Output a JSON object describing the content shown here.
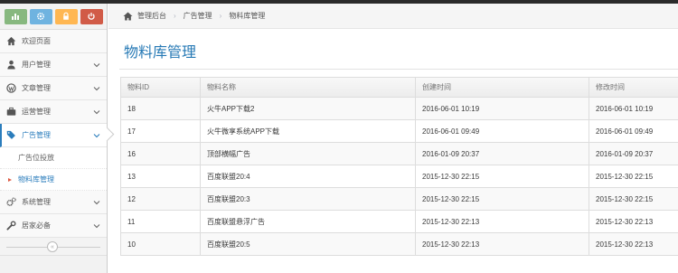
{
  "sidebar": {
    "items": [
      {
        "label": "欢迎页面",
        "icon": "home-icon",
        "has_children": false
      },
      {
        "label": "用户管理",
        "icon": "user-icon",
        "has_children": true
      },
      {
        "label": "文章管理",
        "icon": "wordpress-icon",
        "has_children": true
      },
      {
        "label": "运营管理",
        "icon": "briefcase-icon",
        "has_children": true
      },
      {
        "label": "广告管理",
        "icon": "tags-icon",
        "has_children": true,
        "open": true
      },
      {
        "label": "系统管理",
        "icon": "cogs-icon",
        "has_children": true
      },
      {
        "label": "居家必备",
        "icon": "wrench-icon",
        "has_children": true
      }
    ],
    "subitems": [
      "广告位投放",
      "物料库管理"
    ]
  },
  "breadcrumb": {
    "home": "管理后台",
    "level1": "广告管理",
    "level2": "物料库管理"
  },
  "page": {
    "title": "物料库管理"
  },
  "table": {
    "columns": [
      "物料ID",
      "物料名称",
      "创建时间",
      "修改时间"
    ],
    "rows": [
      [
        "18",
        "火牛APP下载2",
        "2016-06-01 10:19",
        "2016-06-01 10:19"
      ],
      [
        "17",
        "火牛微享系统APP下载",
        "2016-06-01 09:49",
        "2016-06-01 09:49"
      ],
      [
        "16",
        "顶部横幅广告",
        "2016-01-09 20:37",
        "2016-01-09 20:37"
      ],
      [
        "13",
        "百度联盟20:4",
        "2015-12-30 22:15",
        "2015-12-30 22:15"
      ],
      [
        "12",
        "百度联盟20:3",
        "2015-12-30 22:15",
        "2015-12-30 22:15"
      ],
      [
        "11",
        "百度联盟悬浮广告",
        "2015-12-30 22:13",
        "2015-12-30 22:13"
      ],
      [
        "10",
        "百度联盟20:5",
        "2015-12-30 22:13",
        "2015-12-30 22:13"
      ]
    ]
  },
  "colors": {
    "accent": "#2679b5",
    "shortcut_green": "#87b87f",
    "shortcut_blue": "#6fb3e0",
    "shortcut_yellow": "#ffb752",
    "shortcut_red": "#d15b47"
  }
}
